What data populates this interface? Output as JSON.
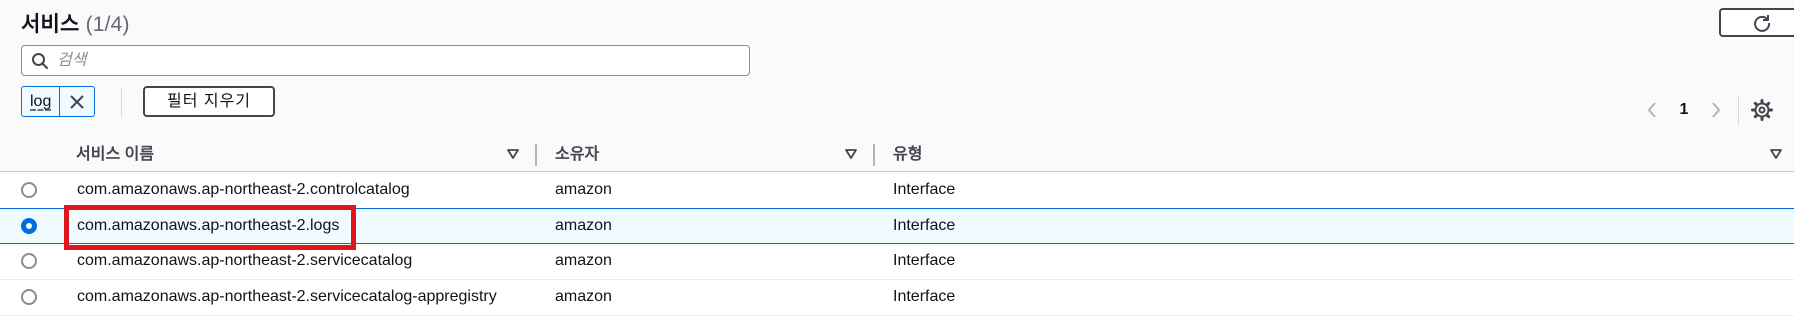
{
  "header": {
    "title": "서비스",
    "count": "(1/4)",
    "refresh_icon": "refresh-icon"
  },
  "search": {
    "placeholder": "검색",
    "value": "",
    "icon": "search-icon"
  },
  "filter": {
    "token_label": "log",
    "dismiss_icon": "close-icon",
    "clear_label": "필터 지우기"
  },
  "pagination": {
    "current_page": "1",
    "prev_icon": "chevron-left-icon",
    "next_icon": "chevron-right-icon",
    "settings_icon": "gear-icon"
  },
  "table": {
    "columns": [
      {
        "label": "서비스 이름"
      },
      {
        "label": "소유자"
      },
      {
        "label": "유형"
      }
    ],
    "rows": [
      {
        "name": "com.amazonaws.ap-northeast-2.controlcatalog",
        "owner": "amazon",
        "type": "Interface",
        "selected": false
      },
      {
        "name": "com.amazonaws.ap-northeast-2.logs",
        "owner": "amazon",
        "type": "Interface",
        "selected": true
      },
      {
        "name": "com.amazonaws.ap-northeast-2.servicecatalog",
        "owner": "amazon",
        "type": "Interface",
        "selected": false
      },
      {
        "name": "com.amazonaws.ap-northeast-2.servicecatalog-appregistry",
        "owner": "amazon",
        "type": "Interface",
        "selected": false
      }
    ]
  },
  "colors": {
    "accent": "#006ce0",
    "highlight": "#e0161d"
  }
}
